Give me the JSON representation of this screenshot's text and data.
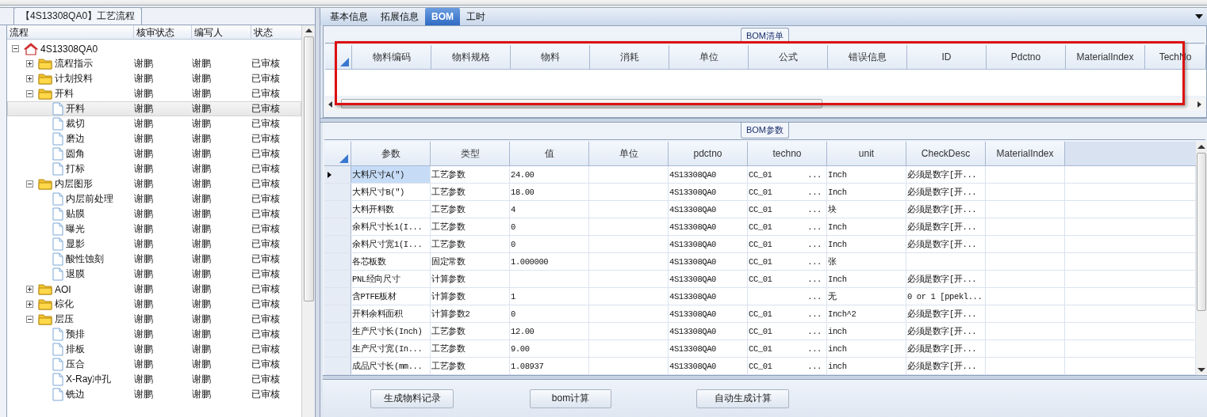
{
  "left_panel": {
    "title": "【4S13308QA0】工艺流程",
    "columns": [
      "流程",
      "核审状态",
      "编写人",
      "状态"
    ],
    "tree": [
      {
        "label": "4S13308QA0",
        "kind": "root",
        "expanded": true,
        "selected": false,
        "children": [
          {
            "label": "流程指示",
            "kind": "folder",
            "expanded": false,
            "selected": false,
            "reviewer": "谢鹏",
            "writer": "谢鹏",
            "status": "已审核"
          },
          {
            "label": "计划投料",
            "kind": "folder",
            "expanded": false,
            "selected": false,
            "reviewer": "谢鹏",
            "writer": "谢鹏",
            "status": "已审核"
          },
          {
            "label": "开料",
            "kind": "folder",
            "expanded": true,
            "selected": false,
            "reviewer": "谢鹏",
            "writer": "谢鹏",
            "status": "已审核",
            "children": [
              {
                "label": "开料",
                "kind": "file",
                "selected": true,
                "reviewer": "谢鹏",
                "writer": "谢鹏",
                "status": "已审核"
              },
              {
                "label": "裁切",
                "kind": "file",
                "selected": false,
                "reviewer": "谢鹏",
                "writer": "谢鹏",
                "status": "已审核"
              },
              {
                "label": "磨边",
                "kind": "file",
                "selected": false,
                "reviewer": "谢鹏",
                "writer": "谢鹏",
                "status": "已审核"
              },
              {
                "label": "圆角",
                "kind": "file",
                "selected": false,
                "reviewer": "谢鹏",
                "writer": "谢鹏",
                "status": "已审核"
              },
              {
                "label": "打标",
                "kind": "file",
                "selected": false,
                "reviewer": "谢鹏",
                "writer": "谢鹏",
                "status": "已审核"
              }
            ]
          },
          {
            "label": "内层图形",
            "kind": "folder",
            "expanded": true,
            "selected": false,
            "reviewer": "谢鹏",
            "writer": "谢鹏",
            "status": "已审核",
            "children": [
              {
                "label": "内层前处理",
                "kind": "file",
                "selected": false,
                "reviewer": "谢鹏",
                "writer": "谢鹏",
                "status": "已审核"
              },
              {
                "label": "贴膜",
                "kind": "file",
                "selected": false,
                "reviewer": "谢鹏",
                "writer": "谢鹏",
                "status": "已审核"
              },
              {
                "label": "曝光",
                "kind": "file",
                "selected": false,
                "reviewer": "谢鹏",
                "writer": "谢鹏",
                "status": "已审核"
              },
              {
                "label": "显影",
                "kind": "file",
                "selected": false,
                "reviewer": "谢鹏",
                "writer": "谢鹏",
                "status": "已审核"
              },
              {
                "label": "酸性蚀刻",
                "kind": "file",
                "selected": false,
                "reviewer": "谢鹏",
                "writer": "谢鹏",
                "status": "已审核"
              },
              {
                "label": "退膜",
                "kind": "file",
                "selected": false,
                "reviewer": "谢鹏",
                "writer": "谢鹏",
                "status": "已审核"
              }
            ]
          },
          {
            "label": "AOI",
            "kind": "folder",
            "expanded": false,
            "selected": false,
            "reviewer": "谢鹏",
            "writer": "谢鹏",
            "status": "已审核"
          },
          {
            "label": "棕化",
            "kind": "folder",
            "expanded": false,
            "selected": false,
            "reviewer": "谢鹏",
            "writer": "谢鹏",
            "status": "已审核"
          },
          {
            "label": "层压",
            "kind": "folder",
            "expanded": true,
            "selected": false,
            "reviewer": "谢鹏",
            "writer": "谢鹏",
            "status": "已审核",
            "children": [
              {
                "label": "预排",
                "kind": "file",
                "selected": false,
                "reviewer": "谢鹏",
                "writer": "谢鹏",
                "status": "已审核"
              },
              {
                "label": "排板",
                "kind": "file",
                "selected": false,
                "reviewer": "谢鹏",
                "writer": "谢鹏",
                "status": "已审核"
              },
              {
                "label": "压合",
                "kind": "file",
                "selected": false,
                "reviewer": "谢鹏",
                "writer": "谢鹏",
                "status": "已审核"
              },
              {
                "label": "X-Ray冲孔",
                "kind": "file",
                "selected": false,
                "reviewer": "谢鹏",
                "writer": "谢鹏",
                "status": "已审核"
              },
              {
                "label": "铣边",
                "kind": "file",
                "selected": false,
                "reviewer": "谢鹏",
                "writer": "谢鹏",
                "status": "已审核"
              }
            ]
          }
        ]
      }
    ]
  },
  "tabs": [
    {
      "label": "基本信息",
      "selected": false
    },
    {
      "label": "拓展信息",
      "selected": false
    },
    {
      "label": "BOM",
      "selected": true
    },
    {
      "label": "工时",
      "selected": false
    }
  ],
  "bom_list": {
    "title": "BOM清单",
    "columns": [
      "物料编码",
      "物料规格",
      "物料",
      "消耗",
      "单位",
      "公式",
      "错误信息",
      "ID",
      "Pdctno",
      "MaterialIndex",
      "TechNo"
    ]
  },
  "bom_params": {
    "title": "BOM参数",
    "columns": [
      "参数",
      "类型",
      "值",
      "单位",
      "pdctno",
      "techno",
      "unit",
      "CheckDesc",
      "MaterialIndex"
    ],
    "rows": [
      {
        "current": true,
        "selected": true,
        "param": "大料尺寸A(\")",
        "type": "工艺参数",
        "value": "24.00",
        "pdctno": "4S13308QA0",
        "techno": "CC_01",
        "techno_button": "...",
        "unit": "Inch",
        "check_desc": "必须是数字[开..."
      },
      {
        "current": false,
        "selected": false,
        "param": "大料尺寸B(\")",
        "type": "工艺参数",
        "value": "18.00",
        "pdctno": "4S13308QA0",
        "techno": "CC_01",
        "techno_button": "...",
        "unit": "Inch",
        "check_desc": "必须是数字[开..."
      },
      {
        "current": false,
        "selected": false,
        "param": "大料开料数",
        "type": "工艺参数",
        "value": "4",
        "pdctno": "4S13308QA0",
        "techno": "CC_01",
        "techno_button": "...",
        "unit": "块",
        "check_desc": "必须是数字[开..."
      },
      {
        "current": false,
        "selected": false,
        "param": "余料尺寸长1(I...",
        "type": "工艺参数",
        "value": "0",
        "pdctno": "4S13308QA0",
        "techno": "CC_01",
        "techno_button": "...",
        "unit": "Inch",
        "check_desc": "必须是数字[开..."
      },
      {
        "current": false,
        "selected": false,
        "param": "余料尺寸宽1(I...",
        "type": "工艺参数",
        "value": "0",
        "pdctno": "4S13308QA0",
        "techno": "CC_01",
        "techno_button": "...",
        "unit": "Inch",
        "check_desc": "必须是数字[开..."
      },
      {
        "current": false,
        "selected": false,
        "param": "各芯板数",
        "type": "固定常数",
        "value": "1.000000",
        "pdctno": "4S13308QA0",
        "techno": "CC_01",
        "techno_button": "...",
        "unit": "张"
      },
      {
        "current": false,
        "selected": false,
        "param": "PNL经向尺寸",
        "type": "计算参数",
        "pdctno": "4S13308QA0",
        "techno": "CC_01",
        "techno_button": "...",
        "unit": "Inch",
        "check_desc": "必须是数字[开..."
      },
      {
        "current": false,
        "selected": false,
        "param": "含PTFE板材",
        "type": "计算参数",
        "value": "1",
        "pdctno": "4S13308QA0",
        "techno_button": "...",
        "unit": "无",
        "check_desc": "0 or 1 [ppekl..."
      },
      {
        "current": false,
        "selected": false,
        "param": "开料余料面积",
        "type": "计算参数2",
        "value": "0",
        "pdctno": "4S13308QA0",
        "techno": "CC_01",
        "techno_button": "...",
        "unit": "Inch^2",
        "check_desc": "必须是数字[开..."
      },
      {
        "current": false,
        "selected": false,
        "param": "生产尺寸长(Inch)",
        "type": "工艺参数",
        "value": "12.00",
        "pdctno": "4S13308QA0",
        "techno": "CC_01",
        "techno_button": "...",
        "unit": "inch",
        "check_desc": "必须是数字[开..."
      },
      {
        "current": false,
        "selected": false,
        "param": "生产尺寸宽(In...",
        "type": "工艺参数",
        "value": "9.00",
        "pdctno": "4S13308QA0",
        "techno": "CC_01",
        "techno_button": "...",
        "unit": "inch",
        "check_desc": "必须是数字[开..."
      },
      {
        "current": false,
        "selected": false,
        "param": "成品尺寸长(mm...",
        "type": "工艺参数",
        "value": "1.08937",
        "pdctno": "4S13308QA0",
        "techno": "CC_01",
        "techno_button": "...",
        "unit": "inch",
        "check_desc": "必须是数字[开..."
      }
    ]
  },
  "buttons": [
    "生成物料记录",
    "bom计算",
    "自动生成计算"
  ]
}
